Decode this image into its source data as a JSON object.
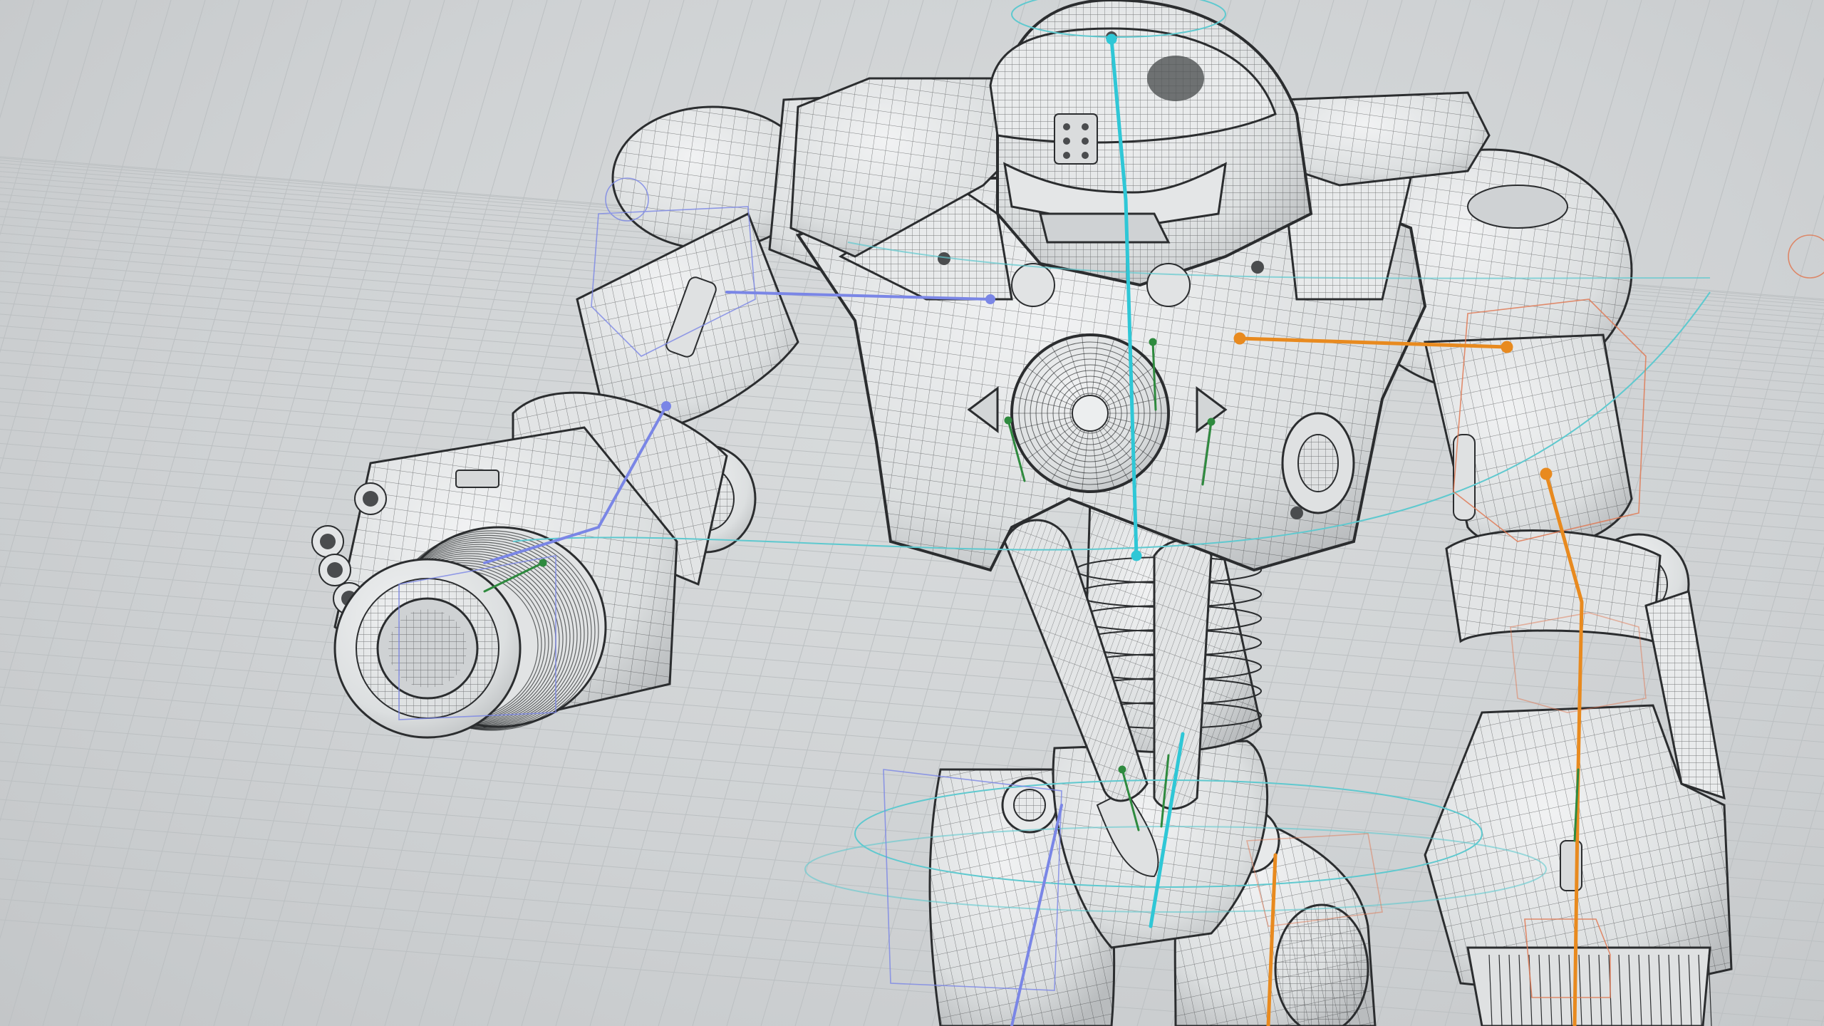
{
  "viewport": {
    "mode": "wireframe-on-shaded",
    "background_color": "#cfd2d4",
    "grid_color": "#bfc3c5",
    "mesh_color": "#2b2d2f",
    "surface_color": "#e4e6e7"
  },
  "rig": {
    "spine_color": "#2fc7d6",
    "left_arm_color": "#7a86e6",
    "right_arm_color": "#e88a1f",
    "helper_bone_color": "#2e8a3e",
    "control_curve_color": "#5fc9cf",
    "ik_box_color": "#e07a55"
  },
  "model": {
    "subject": "robot-character",
    "parts": [
      "helmet",
      "torso",
      "chest-core",
      "left-shoulder",
      "right-shoulder",
      "left-arm",
      "left-cannon",
      "right-arm",
      "right-forearm",
      "spine",
      "pelvis",
      "left-leg",
      "right-leg"
    ]
  }
}
